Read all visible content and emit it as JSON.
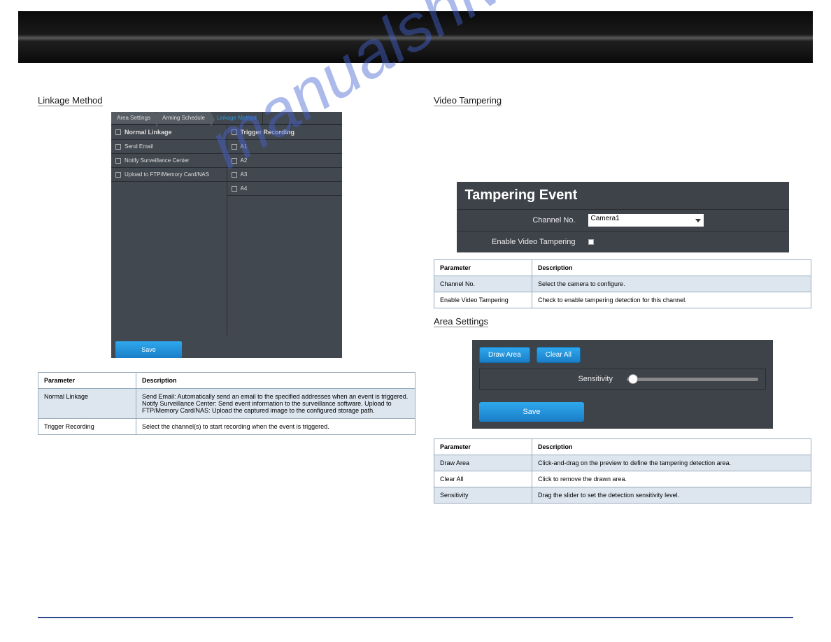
{
  "watermark": "manualshive.com",
  "left": {
    "heading": "Linkage Method",
    "tabs": [
      "Area Settings",
      "Arming Schedule",
      "Linkage Method"
    ],
    "active_tab": 2,
    "normal_linkage_header": "Normal Linkage",
    "trigger_recording_header": "Trigger Recording",
    "normal_items": [
      "Send Email",
      "Notify Surveillance Center",
      "Upload to FTP/Memory Card/NAS"
    ],
    "trigger_items": [
      "A1",
      "A2",
      "A3",
      "A4"
    ],
    "save_button": "Save",
    "table": {
      "header": [
        "Parameter",
        "Description"
      ],
      "rows": [
        {
          "k": "Normal Linkage",
          "v": "Send Email: Automatically send an email to the specified addresses when an event is triggered. Notify Surveillance Center: Send event information to the surveillance software. Upload to FTP/Memory Card/NAS: Upload the captured image to the configured storage path."
        },
        {
          "k": "Trigger Recording",
          "v": "Select the channel(s) to start recording when the event is triggered."
        }
      ]
    }
  },
  "right": {
    "heading": "Video Tampering",
    "panel_title": "Tampering Event",
    "channel_no_label": "Channel No.",
    "channel_no_value": "Camera1",
    "enable_label": "Enable Video Tampering",
    "table1": {
      "header": [
        "Parameter",
        "Description"
      ],
      "rows": [
        {
          "k": "Channel No.",
          "v": "Select the camera to configure."
        },
        {
          "k": "Enable Video Tampering",
          "v": "Check to enable tampering detection for this channel."
        }
      ]
    },
    "area_heading": "Area Settings",
    "draw_area": "Draw Area",
    "clear_all": "Clear All",
    "sensitivity_label": "Sensitivity",
    "save_button": "Save",
    "table2": {
      "header": [
        "Parameter",
        "Description"
      ],
      "rows": [
        {
          "k": "Draw Area",
          "v": "Click-and-drag on the preview to define the tampering detection area."
        },
        {
          "k": "Clear All",
          "v": "Click to remove the drawn area."
        },
        {
          "k": "Sensitivity",
          "v": "Drag the slider to set the detection sensitivity level."
        }
      ]
    }
  }
}
